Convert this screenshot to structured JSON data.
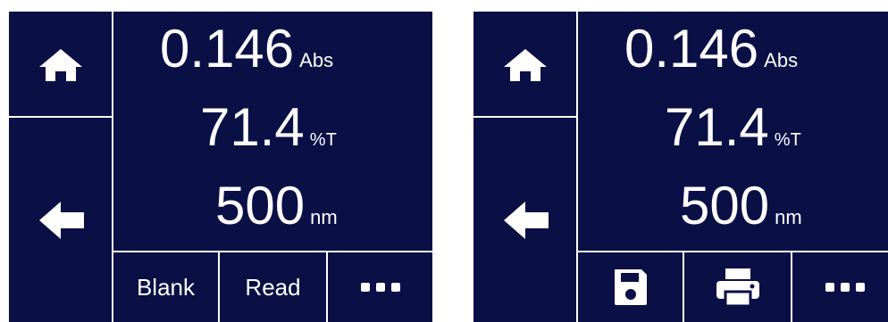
{
  "screens": [
    {
      "abs_value": "0.146",
      "abs_unit": "Abs",
      "transmittance_value": "71.4",
      "transmittance_unit": "%T",
      "wavelength_value": "500",
      "wavelength_unit": "nm",
      "buttons": [
        "Blank",
        "Read",
        "more-icon"
      ]
    },
    {
      "abs_value": "0.146",
      "abs_unit": "Abs",
      "transmittance_value": "71.4",
      "transmittance_unit": "%T",
      "wavelength_value": "500",
      "wavelength_unit": "nm",
      "buttons": [
        "save-icon",
        "print-icon",
        "more-icon"
      ]
    }
  ],
  "colors": {
    "background": "#0a0f45",
    "foreground": "#ffffff"
  },
  "icons": [
    "home-icon",
    "back-arrow-icon",
    "save-icon",
    "print-icon",
    "more-icon"
  ]
}
